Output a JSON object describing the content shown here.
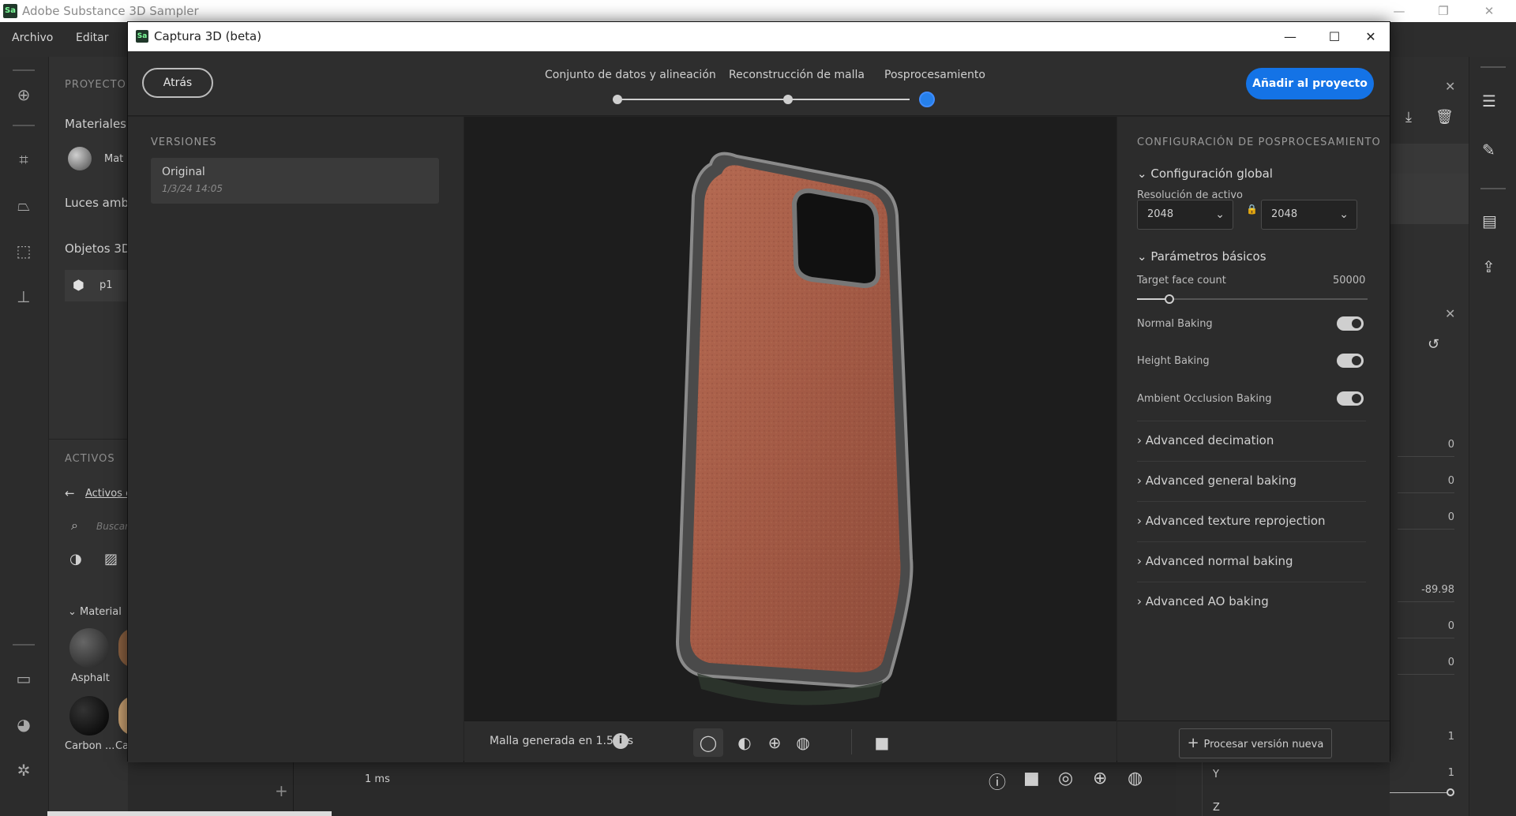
{
  "app": {
    "title": "Adobe Substance 3D Sampler",
    "logo": "Sa",
    "menu": [
      "Archivo",
      "Editar"
    ]
  },
  "background_left": {
    "project_caption": "PROYECTO",
    "materials": "Materiales",
    "material_item": "Mat",
    "ambient_lights": "Luces amb",
    "objects_3d": "Objetos 3D",
    "object_item": "p1",
    "assets_caption": "ACTIVOS",
    "assets_link": "Activos c",
    "search_placeholder": "Buscar",
    "materials_group": "Material",
    "asset_names": [
      "Asphalt",
      "Carbon ...",
      "Ca"
    ]
  },
  "background_right": {
    "values": [
      "0",
      "0",
      "0",
      "-89.98",
      "0",
      "0",
      "1",
      "1"
    ],
    "y_label": "Y",
    "z_label": "Z"
  },
  "background_bottom": {
    "time": "1 ms"
  },
  "modal": {
    "title": "Captura 3D (beta)",
    "logo": "Sa",
    "back_label": "Atrás",
    "steps": [
      "Conjunto de datos y alineación",
      "Reconstrucción de malla",
      "Posprocesamiento"
    ],
    "add_to_project_label": "Añadir al proyecto",
    "versions": {
      "caption": "VERSIONES",
      "items": [
        {
          "name": "Original",
          "date": "1/3/24 14:05"
        }
      ]
    },
    "viewport": {
      "mesh_status": "Malla generada en 1.523s"
    },
    "settings": {
      "caption": "CONFIGURACIÓN DE POSPROCESAMIENTO",
      "global_heading": "Configuración global",
      "resolution_label": "Resolución de activo",
      "resolution_width": "2048",
      "resolution_height": "2048",
      "basic_heading": "Parámetros básicos",
      "face_count_label": "Target face count",
      "face_count_value": "50000",
      "face_count_fraction": 0.14,
      "normal_baking": "Normal Baking",
      "height_baking": "Height Baking",
      "ao_baking": "Ambient Occlusion Baking",
      "toggles_on": [
        true,
        true,
        true
      ],
      "advanced": [
        "Advanced decimation",
        "Advanced general baking",
        "Advanced texture reprojection",
        "Advanced normal baking",
        "Advanced AO baking"
      ],
      "process_label": "Procesar versión nueva"
    }
  }
}
